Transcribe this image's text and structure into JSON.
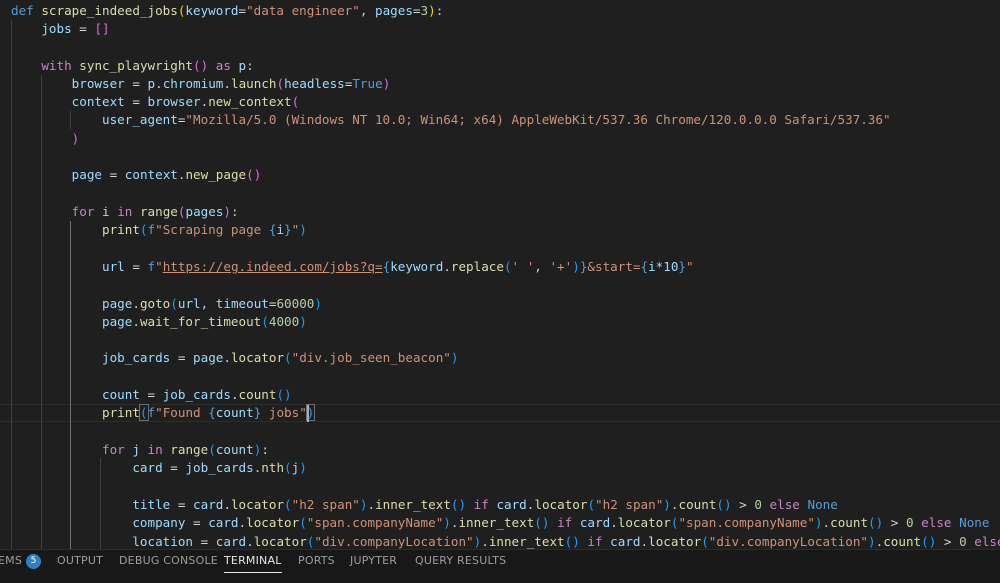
{
  "code": {
    "def_kw": "def",
    "func_name": "scrape_indeed_jobs",
    "param_keyword": "keyword",
    "default_keyword": "\"data engineer\"",
    "param_pages": "pages",
    "default_pages": "3",
    "jobs_var": "jobs",
    "with_kw": "with",
    "sync_fn": "sync_playwright",
    "as_kw": "as",
    "p_var": "p",
    "browser_var": "browser",
    "chromium_attr": "chromium",
    "launch_fn": "launch",
    "headless_param": "headless",
    "true_kw": "True",
    "context_var": "context",
    "new_context_fn": "new_context",
    "user_agent_param": "user_agent",
    "user_agent_value": "\"Mozilla/5.0 (Windows NT 10.0; Win64; x64) AppleWebKit/537.36 Chrome/120.0.0.0 Safari/537.36\"",
    "page_var": "page",
    "new_page_fn": "new_page",
    "for_kw": "for",
    "i_var": "i",
    "in_kw": "in",
    "range_fn": "range",
    "print_fn": "print",
    "f_prefix": "f",
    "scraping_str": "\"Scraping page ",
    "url_var": "url",
    "url_str": "\"https://eg.indeed.com/jobs?q=",
    "replace_fn": "replace",
    "space_str": "' '",
    "plus_str": "'+'",
    "start_str": "&start=",
    "mult_expr": "i*10",
    "close_quote": "\"",
    "goto_fn": "goto",
    "timeout_param": "timeout",
    "timeout_value": "60000",
    "wait_fn": "wait_for_timeout",
    "wait_value": "4000",
    "job_cards_var": "job_cards",
    "locator_fn": "locator",
    "job_seen_beacon": "\"div.job_seen_beacon\"",
    "count_var": "count",
    "count_fn": "count",
    "found_str": "\"Found ",
    "jobs_str": " jobs\"",
    "j_var": "j",
    "card_var": "card",
    "nth_fn": "nth",
    "title_var": "title",
    "h2_span": "\"h2 span\"",
    "inner_text_fn": "inner_text",
    "if_kw": "if",
    "zero": "0",
    "else_kw": "else",
    "none_kw": "None",
    "company_var": "company",
    "company_name": "\"span.companyName\"",
    "location_var": "location",
    "company_location": "\"div.companyLocation\""
  },
  "panel": {
    "tabs": [
      {
        "label": "EMS",
        "badge": "5"
      },
      {
        "label": "OUTPUT"
      },
      {
        "label": "DEBUG CONSOLE"
      },
      {
        "label": "TERMINAL"
      },
      {
        "label": "PORTS"
      },
      {
        "label": "JUPYTER"
      },
      {
        "label": "QUERY RESULTS"
      }
    ],
    "active_tab": "TERMINAL"
  },
  "colors": {
    "editor_bg": "#1f1f1f",
    "keyword": "#569cd6",
    "control": "#c586c0",
    "function": "#dcdcaa",
    "variable": "#9cdcfe",
    "string": "#ce9178",
    "number": "#b5cea8",
    "badge": "#2f7fc1"
  }
}
